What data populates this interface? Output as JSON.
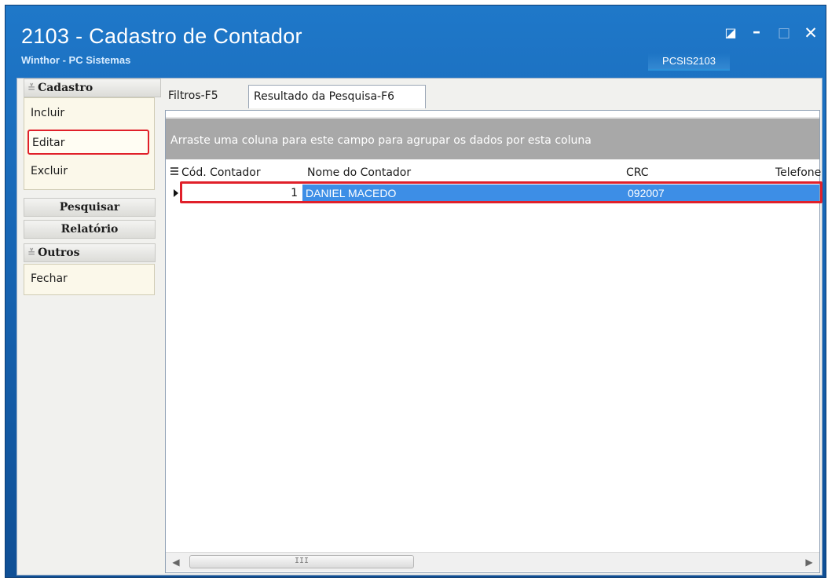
{
  "window": {
    "title": "2103 - Cadastro de Contador",
    "subtitle": "Winthor - PC Sistemas",
    "module_code": "PCSIS2103",
    "buttons": {
      "edit": "◪",
      "minimize": "–",
      "maximize": "□",
      "close": "✕"
    }
  },
  "sidebar": {
    "groups": [
      {
        "label": "Cadastro",
        "items": [
          "Incluir",
          "Editar",
          "Excluir"
        ],
        "highlighted": "Editar"
      },
      {
        "label": "Pesquisar"
      },
      {
        "label": "Relatório"
      },
      {
        "label": "Outros",
        "items": [
          "Fechar"
        ]
      }
    ]
  },
  "tabs": [
    "Filtros-F5",
    "Resultado da Pesquisa-F6"
  ],
  "grid": {
    "group_hint": "Arraste uma coluna para este campo para agrupar os dados por esta coluna",
    "columns": [
      "Cód. Contador",
      "Nome do Contador",
      "CRC",
      "Telefone"
    ],
    "rows": [
      {
        "codigo": "1",
        "nome": "DANIEL MACEDO",
        "crc": "092007",
        "telefone": ""
      }
    ],
    "scroll_thumb": "III"
  },
  "colors": {
    "title_bar": "#1766b5",
    "selection": "#3d8ee6",
    "highlight_outline": "#e0202a",
    "group_panel": "#a8a8a8"
  }
}
